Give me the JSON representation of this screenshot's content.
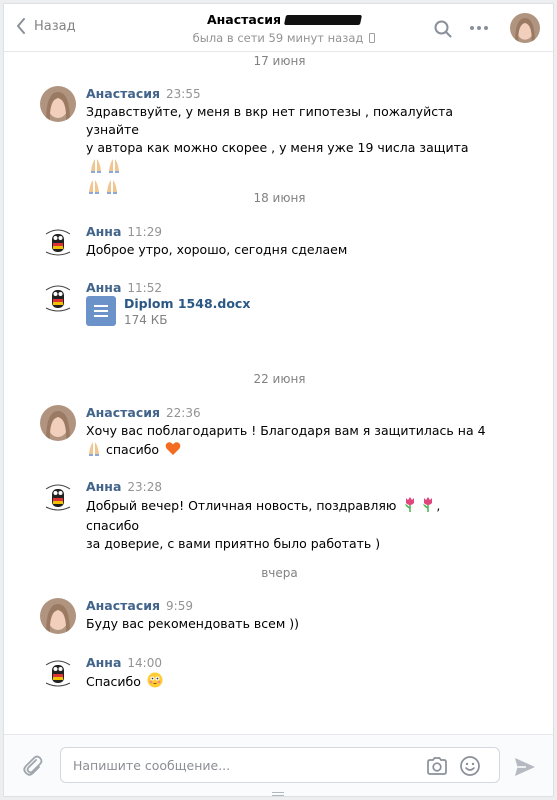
{
  "header": {
    "back_label": "Назад",
    "contact_name": "Анастасия",
    "status": "была в сети 59 минут назад"
  },
  "composer": {
    "placeholder": "Напишите сообщение..."
  },
  "messages": {
    "d1": "17 июня",
    "m1_author": "Анастасия",
    "m1_time": "23:55",
    "m1_line1": "Здравствуйте, у меня в вкр нет гипотезы , пожалуйста узнайте",
    "m1_line2": "у автора как можно скорее , у меня уже 19 числа защита",
    "d2": "18 июня",
    "m2_author": "Анна",
    "m2_time": "11:29",
    "m2_text": "Доброе утро, хорошо, сегодня сделаем",
    "m3_author": "Анна",
    "m3_time": "11:52",
    "m3_file_name": "Diplom 1548.docx",
    "m3_file_size": "174 КБ",
    "d3": "22 июня",
    "m4_author": "Анастасия",
    "m4_time": "22:36",
    "m4_line1": "Хочу вас поблагодарить ! Благодаря вам я защитилась на 4",
    "m4_line2": "спасибо",
    "m5_author": "Анна",
    "m5_time": "23:28",
    "m5_line1": "Добрый вечер! Отличная новость, поздравляю",
    "m5_line1_end": ", спасибо",
    "m5_line2": "за доверие, с вами приятно было работать )",
    "d4": "вчера",
    "m6_author": "Анастасия",
    "m6_time": "9:59",
    "m6_text": "Буду вас рекомендовать всем ))",
    "m7_author": "Анна",
    "m7_time": "14:00",
    "m7_text": "Спасибо"
  },
  "colors": {
    "author_link": "#42648b",
    "accent": "#5181b8",
    "file_icon": "#6b93c9"
  },
  "icons": [
    "back-chevron-icon",
    "search-icon",
    "more-dots-icon",
    "phone-icon",
    "attach-icon",
    "camera-icon",
    "smile-icon",
    "send-icon",
    "document-icon",
    "praying-hands-emoji",
    "heart-emoji",
    "tulip-emoji",
    "flushed-face-emoji"
  ]
}
